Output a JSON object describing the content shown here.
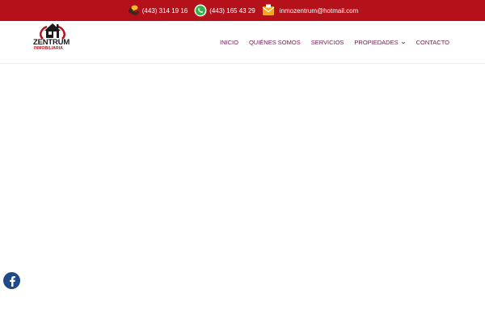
{
  "topbar": {
    "phone": "(443) 314 19 16",
    "whatsapp": "(443) 165 43 29",
    "email": "inmozentrum@hotmail.com"
  },
  "logo": {
    "brand": "ZENTRUM",
    "subtitle": "INMOBILIARIA"
  },
  "nav": {
    "items": [
      "INICIO",
      "QUIÉNES SOMOS",
      "SERVICIOS",
      "PROPIEDADES",
      "CONTACTO"
    ]
  },
  "colors": {
    "topbar_bg": "#b5111a",
    "nav_text": "#6c1a4e",
    "facebook": "#1f4a8a"
  },
  "icons": {
    "phone": "phone-icon",
    "whatsapp": "whatsapp-icon",
    "email": "email-icon",
    "facebook": "facebook-icon",
    "dropdown": "chevron-down-icon"
  }
}
